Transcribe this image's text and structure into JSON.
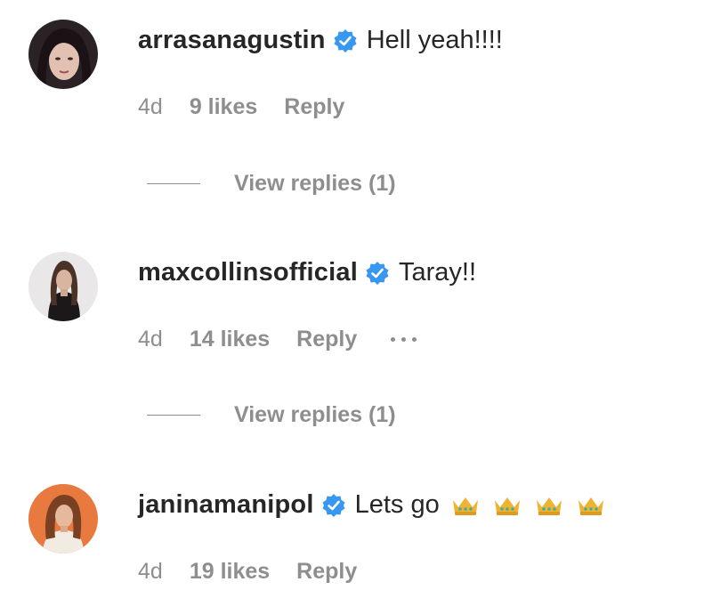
{
  "comments": [
    {
      "username": "arrasanagustin",
      "text": "Hell yeah!!!!",
      "time": "4d",
      "likes": "9 likes",
      "reply_label": "Reply",
      "view_replies": "View replies (1)"
    },
    {
      "username": "maxcollinsofficial",
      "text": "Taray!!",
      "time": "4d",
      "likes": "14 likes",
      "reply_label": "Reply",
      "view_replies": "View replies (1)"
    },
    {
      "username": "janinamanipol",
      "text": "Lets go",
      "time": "4d",
      "likes": "19 likes",
      "reply_label": "Reply"
    }
  ],
  "icons": {
    "verified": "verified-badge-icon",
    "more": "more-options-icon",
    "crown": "crown-emoji-icon"
  },
  "colors": {
    "verified_blue": "#3897f0",
    "text_primary": "#262626",
    "text_secondary": "#8e8e8e",
    "crown_gold": "#f0b330"
  }
}
